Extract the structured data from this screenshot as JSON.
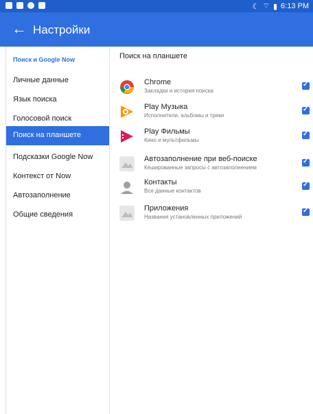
{
  "statusbar": {
    "time": "6:13 PM"
  },
  "toolbar": {
    "title": "Настройки",
    "back_icon": "arrow-left-icon"
  },
  "nav": {
    "header": "Поиск и Google Now",
    "items": [
      {
        "label": "Личные данные"
      },
      {
        "label": "Язык поиска"
      },
      {
        "label": "Голосовой поиск"
      },
      {
        "label": "Поиск на планшете",
        "active": true
      },
      {
        "label": "Подсказки Google Now"
      },
      {
        "label": "Контекст от Now"
      },
      {
        "label": "Автозаполнение"
      },
      {
        "label": "Общие сведения"
      }
    ]
  },
  "content": {
    "header": "Поиск на планшете",
    "items": [
      {
        "title": "Chrome",
        "subtitle": "Закладки и история поиска",
        "checked": true,
        "icon": "chrome-icon"
      },
      {
        "title": "Play Музыка",
        "subtitle": "Исполнители, альбомы и треки",
        "checked": true,
        "icon": "play-music-icon"
      },
      {
        "title": "Play Фильмы",
        "subtitle": "Кино и мультфильмы",
        "checked": true,
        "icon": "play-movies-icon"
      },
      {
        "title": "Автозаполнение при веб-поиске",
        "subtitle": "Кешированные запросы с автозаполнением",
        "checked": true,
        "icon": "autofill-icon"
      },
      {
        "title": "Контакты",
        "subtitle": "Все данные контактов",
        "checked": true,
        "icon": "contacts-icon"
      },
      {
        "title": "Приложения",
        "subtitle": "Названия установленных приложений",
        "checked": true,
        "icon": "apps-icon"
      }
    ]
  }
}
